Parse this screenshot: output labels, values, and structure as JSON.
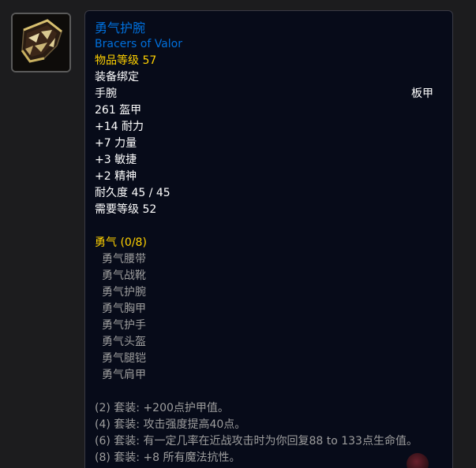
{
  "item": {
    "icon_name": "bracers-of-valor-icon",
    "name_cn": "勇气护腕",
    "name_en": "Bracers of Valor",
    "item_level": "物品等级 57",
    "binding": "装备绑定",
    "slot": "手腕",
    "armor_type": "板甲",
    "armor": "261 盔甲",
    "stats": [
      "+14 耐力",
      "+7 力量",
      "+3 敏捷",
      "+2 精神"
    ],
    "durability": "耐久度 45 / 45",
    "required_level": "需要等级 52"
  },
  "set": {
    "title": "勇气 (0/8)",
    "pieces": [
      "勇气腰带",
      "勇气战靴",
      "勇气护腕",
      "勇气胸甲",
      "勇气护手",
      "勇气头盔",
      "勇气腿铠",
      "勇气肩甲"
    ],
    "bonuses": [
      "(2) 套装: +200点护甲值。",
      "(4) 套装: 攻击强度提高40点。",
      "(6) 套装: 有一定几率在近战攻击时为你回复88 to 133点生命值。",
      "(8) 套装: +8 所有魔法抗性。"
    ]
  },
  "colors": {
    "name": "#0070dd",
    "gold": "#ffd100",
    "white": "#ffffff",
    "gray": "#9d9d9d",
    "tooltip_bg": "#070b19",
    "page_bg": "#1c1c1e"
  }
}
